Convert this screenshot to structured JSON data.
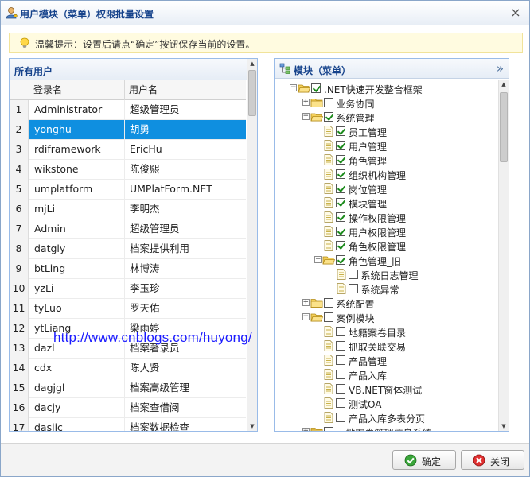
{
  "window": {
    "title": "用户模块（菜单）权限批量设置"
  },
  "tip": {
    "text": "温馨提示：设置后请点“确定”按钮保存当前的设置。"
  },
  "users": {
    "panel_title": "所有用户",
    "columns": [
      "登录名",
      "用户名"
    ],
    "selected_row": 2,
    "rows": [
      {
        "no": "1",
        "login": "Administrator",
        "name": "超级管理员"
      },
      {
        "no": "2",
        "login": "yonghu",
        "name": "胡勇"
      },
      {
        "no": "3",
        "login": "rdiframework",
        "name": "EricHu"
      },
      {
        "no": "4",
        "login": "wikstone",
        "name": "陈俊熙"
      },
      {
        "no": "5",
        "login": "umplatform",
        "name": "UMPlatForm.NET"
      },
      {
        "no": "6",
        "login": "mjLi",
        "name": "李明杰"
      },
      {
        "no": "7",
        "login": "Admin",
        "name": "超级管理员"
      },
      {
        "no": "8",
        "login": "datgly",
        "name": "档案提供利用"
      },
      {
        "no": "9",
        "login": "btLing",
        "name": "林博涛"
      },
      {
        "no": "10",
        "login": "yzLi",
        "name": "李玉珍"
      },
      {
        "no": "11",
        "login": "tyLuo",
        "name": "罗天佑"
      },
      {
        "no": "12",
        "login": "ytLiang",
        "name": "梁雨婷"
      },
      {
        "no": "13",
        "login": "dazl",
        "name": "档案著录员"
      },
      {
        "no": "14",
        "login": "cdx",
        "name": "陈大贤"
      },
      {
        "no": "15",
        "login": "dagjgl",
        "name": "档案高级管理"
      },
      {
        "no": "16",
        "login": "dacjy",
        "name": "档案查借阅"
      },
      {
        "no": "17",
        "login": "dasjjc",
        "name": "档案数据检查"
      }
    ]
  },
  "modules": {
    "panel_title": "模块（菜单）",
    "nodes": [
      {
        "label": ".NET快速开发整合框架",
        "level": 0,
        "expander": "minus",
        "checked": true,
        "icon": "folder-open-icon"
      },
      {
        "label": "业务协同",
        "level": 1,
        "expander": "plus",
        "checked": false,
        "icon": "folder-closed-icon"
      },
      {
        "label": "系统管理",
        "level": 1,
        "expander": "minus",
        "checked": true,
        "icon": "folder-open-icon"
      },
      {
        "label": "员工管理",
        "level": 2,
        "expander": "",
        "checked": true,
        "icon": "page-icon"
      },
      {
        "label": "用户管理",
        "level": 2,
        "expander": "",
        "checked": true,
        "icon": "page-icon"
      },
      {
        "label": "角色管理",
        "level": 2,
        "expander": "",
        "checked": true,
        "icon": "page-icon"
      },
      {
        "label": "组织机构管理",
        "level": 2,
        "expander": "",
        "checked": true,
        "icon": "page-icon"
      },
      {
        "label": "岗位管理",
        "level": 2,
        "expander": "",
        "checked": true,
        "icon": "page-icon"
      },
      {
        "label": "模块管理",
        "level": 2,
        "expander": "",
        "checked": true,
        "icon": "page-icon"
      },
      {
        "label": "操作权限管理",
        "level": 2,
        "expander": "",
        "checked": true,
        "icon": "page-icon"
      },
      {
        "label": "用户权限管理",
        "level": 2,
        "expander": "",
        "checked": true,
        "icon": "page-icon"
      },
      {
        "label": "角色权限管理",
        "level": 2,
        "expander": "",
        "checked": true,
        "icon": "page-icon"
      },
      {
        "label": "角色管理_旧",
        "level": 2,
        "expander": "minus",
        "checked": true,
        "icon": "folder-open-icon"
      },
      {
        "label": "系统日志管理",
        "level": 3,
        "expander": "",
        "checked": false,
        "icon": "page-icon"
      },
      {
        "label": "系统异常",
        "level": 3,
        "expander": "",
        "checked": false,
        "icon": "page-icon"
      },
      {
        "label": "系统配置",
        "level": 1,
        "expander": "plus",
        "checked": false,
        "icon": "folder-closed-icon"
      },
      {
        "label": "案例模块",
        "level": 1,
        "expander": "minus",
        "checked": false,
        "icon": "folder-open-icon"
      },
      {
        "label": "地籍案卷目录",
        "level": 2,
        "expander": "",
        "checked": false,
        "icon": "page-icon"
      },
      {
        "label": "抓取关联交易",
        "level": 2,
        "expander": "",
        "checked": false,
        "icon": "page-icon"
      },
      {
        "label": "产品管理",
        "level": 2,
        "expander": "",
        "checked": false,
        "icon": "page-icon"
      },
      {
        "label": "产品入库",
        "level": 2,
        "expander": "",
        "checked": false,
        "icon": "page-icon"
      },
      {
        "label": "VB.NET窗体测试",
        "level": 2,
        "expander": "",
        "checked": false,
        "icon": "page-icon"
      },
      {
        "label": "测试OA",
        "level": 2,
        "expander": "",
        "checked": false,
        "icon": "page-icon"
      },
      {
        "label": "产品入库多表分页",
        "level": 2,
        "expander": "",
        "checked": false,
        "icon": "page-icon"
      },
      {
        "label": "土地案卷管理信息系统",
        "level": 1,
        "expander": "plus",
        "checked": false,
        "icon": "folder-closed-icon"
      }
    ]
  },
  "watermark": {
    "text": "http://www.cnblogs.com/huyong/"
  },
  "footer": {
    "ok_label": "确定",
    "close_label": "关闭"
  }
}
